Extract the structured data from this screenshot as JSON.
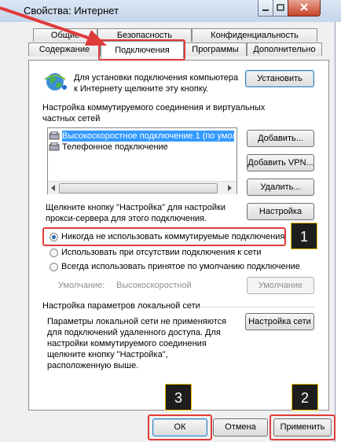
{
  "window": {
    "title": "Свойства: Интернет",
    "controls": [
      "minimize",
      "maximize",
      "close"
    ]
  },
  "tabs": {
    "row1": [
      "Общие",
      "Безопасность",
      "Конфиденциальность"
    ],
    "row2": [
      "Содержание",
      "Подключения",
      "Программы",
      "Дополнительно"
    ],
    "active": "Подключения"
  },
  "setup": {
    "text": "Для установки подключения компьютера к Интернету щелкните эту кнопку.",
    "line1": "Для установки подключения компьютера",
    "line2": "к Интернету щелкните эту кнопку.",
    "button": "Установить"
  },
  "dialup": {
    "heading1": "Настройка коммутируемого соединения и виртуальных",
    "heading2": "частных сетей",
    "connections": [
      {
        "label": "Высокоскоростное подключение 1 (по умол",
        "selected": true
      },
      {
        "label": "Телефонное подключение",
        "selected": false
      }
    ],
    "add_button": "Добавить...",
    "add_vpn_button": "Добавить VPN...",
    "delete_button": "Удалить...",
    "proxy_hint1": "Щелкните кнопку \"Настройка\" для настройки",
    "proxy_hint2": "прокси-сервера для этого подключения.",
    "settings_button": "Настройка",
    "radio_options": [
      {
        "label": "Никогда не использовать коммутируемые подключения",
        "checked": true
      },
      {
        "label": "Использовать при отсутствии подключения к сети",
        "checked": false
      },
      {
        "label": "Всегда использовать принятое по умолчанию подключение",
        "checked": false
      }
    ],
    "default_label": "Умолчание:",
    "default_value": "Высокоскоростной",
    "default_button": "Умолчание"
  },
  "lan": {
    "heading": "Настройка параметров локальной сети",
    "text_lines": [
      "Параметры локальной сети не применяются",
      "для подключений удаленного доступа. Для",
      "настройки коммутируемого соединения",
      "щелкните кнопку \"Настройка\",",
      "расположенную выше."
    ],
    "button": "Настройка сети"
  },
  "footer": {
    "ok": "ОК",
    "cancel": "Отмена",
    "apply": "Применить"
  },
  "annotations": {
    "badges": [
      "1",
      "2",
      "3"
    ],
    "highlight_color": "#e03b3b"
  }
}
